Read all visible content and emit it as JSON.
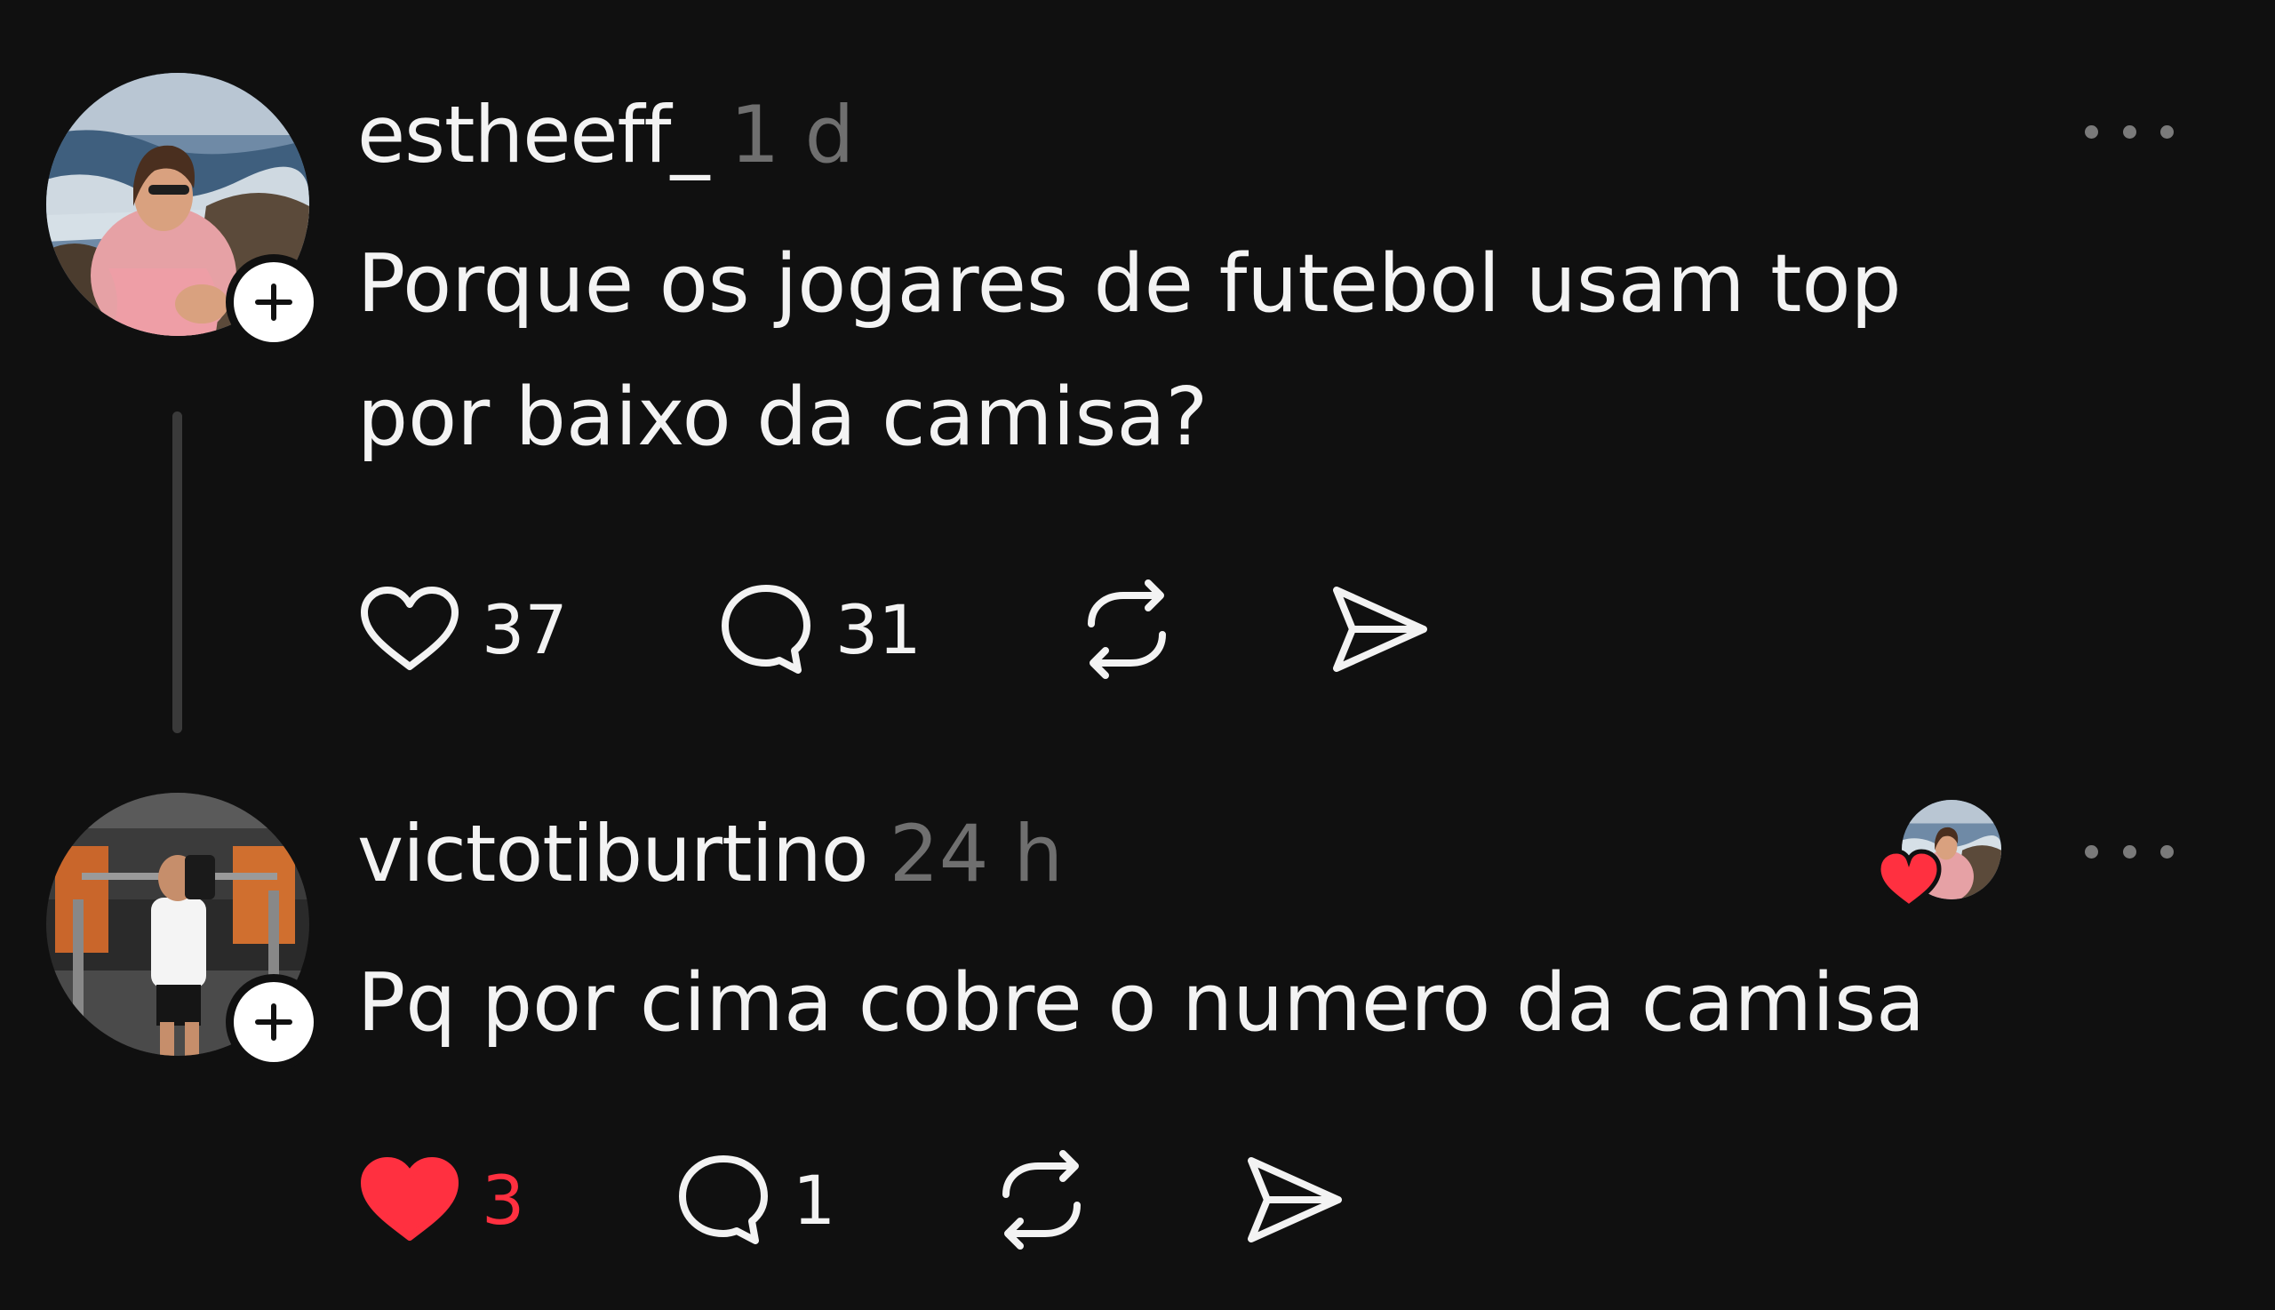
{
  "posts": [
    {
      "username": "estheeff_",
      "time": "1 d",
      "text": "Porque os jogares de futebol usam top por baixo da camisa?",
      "likes": "37",
      "replies": "31",
      "liked": false
    },
    {
      "username": "victotiburtino",
      "time": "24 h",
      "text": "Pq por cima cobre o numero da camisa",
      "likes": "3",
      "replies": "1",
      "liked": true,
      "liked_by_author": true
    }
  ],
  "icons": {
    "follow": "plus-icon",
    "like": "heart-icon",
    "reply": "speech-bubble-icon",
    "repost": "repost-icon",
    "share": "send-icon",
    "more": "ellipsis-icon"
  },
  "colors": {
    "background": "#101010",
    "text": "#f3f3f3",
    "secondary_text": "#6f6f6f",
    "like_red": "#ff3040"
  }
}
